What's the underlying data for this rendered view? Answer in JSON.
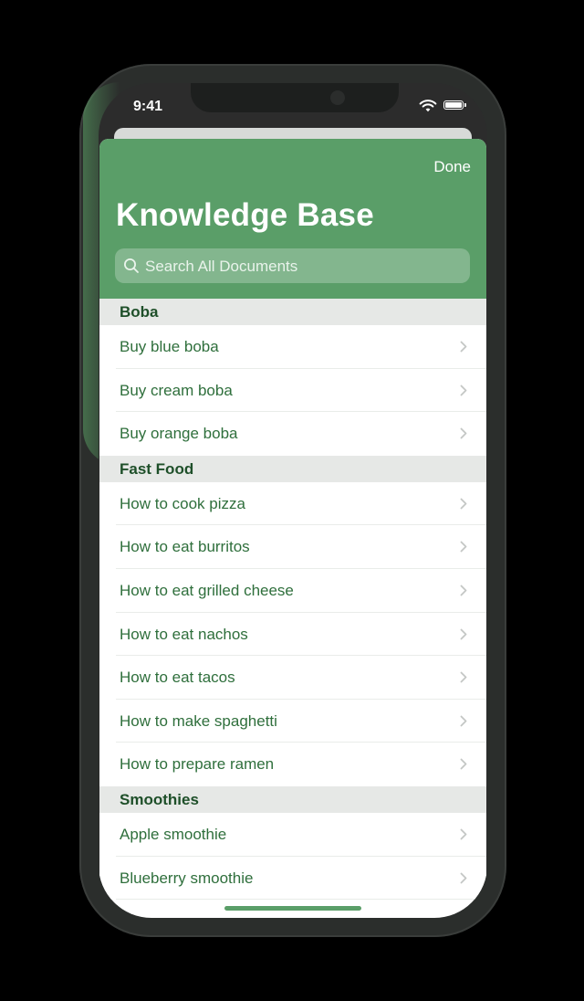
{
  "status_bar": {
    "time": "9:41"
  },
  "sheet": {
    "done_label": "Done",
    "title": "Knowledge Base",
    "search_placeholder": "Search All Documents"
  },
  "sections": [
    {
      "header": "Boba",
      "items": [
        "Buy blue boba",
        "Buy cream boba",
        "Buy orange boba"
      ]
    },
    {
      "header": "Fast Food",
      "items": [
        "How to cook pizza",
        "How to eat burritos",
        "How to eat grilled cheese",
        "How to eat nachos",
        "How to eat tacos",
        "How to make spaghetti",
        "How to prepare ramen"
      ]
    },
    {
      "header": "Smoothies",
      "items": [
        "Apple smoothie",
        "Blueberry smoothie"
      ]
    }
  ],
  "colors": {
    "accent": "#5a9e68",
    "text_green": "#2f6f3c",
    "section_bg": "#e6e8e6"
  },
  "icons": [
    "search-icon",
    "chevron-right-icon",
    "wifi-icon",
    "battery-icon"
  ]
}
